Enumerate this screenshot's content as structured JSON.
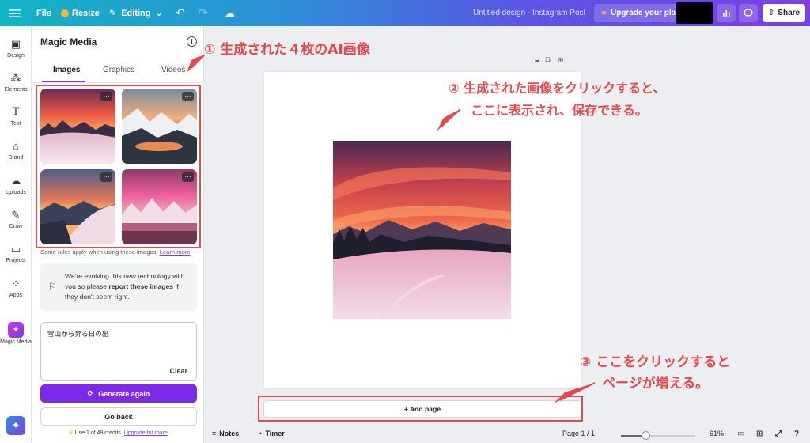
{
  "topbar": {
    "file_label": "File",
    "resize_label": "Resize",
    "editing_label": "Editing",
    "doc_title": "Untitled design - Instagram Post",
    "upgrade_label": "Upgrade your plan",
    "share_label": "Share"
  },
  "rail": {
    "items": [
      {
        "label": "Design",
        "icon": "design-icon"
      },
      {
        "label": "Elements",
        "icon": "elements-icon"
      },
      {
        "label": "Text",
        "icon": "text-icon"
      },
      {
        "label": "Brand",
        "icon": "brand-icon"
      },
      {
        "label": "Uploads",
        "icon": "uploads-icon"
      },
      {
        "label": "Draw",
        "icon": "draw-icon"
      },
      {
        "label": "Projects",
        "icon": "projects-icon"
      },
      {
        "label": "Apps",
        "icon": "apps-icon"
      },
      {
        "label": "Magic Media",
        "icon": "magic-media-icon"
      }
    ]
  },
  "panel": {
    "title": "Magic Media",
    "tabs": [
      {
        "label": "Images",
        "active": true
      },
      {
        "label": "Graphics",
        "active": false
      },
      {
        "label": "Videos",
        "active": false
      }
    ],
    "rules_text": "Some rules apply when using these images.",
    "rules_link": "Learn more",
    "notice_pre": "We're evolving this new technology with you so please ",
    "notice_link": "report these images",
    "notice_post": " if they don't seem right.",
    "prompt_text": "雪山から昇る日の出",
    "clear_label": "Clear",
    "generate_label": "Generate again",
    "back_label": "Go back",
    "credits_text": "Use 1 of 49 credits.",
    "credits_link": "Upgrade for more"
  },
  "canvas": {
    "add_page_label": "+ Add page"
  },
  "bottombar": {
    "notes_label": "Notes",
    "timer_label": "Timer",
    "page_indicator": "Page 1 / 1",
    "zoom_value": 61,
    "zoom_label": "61%"
  },
  "annotations": {
    "a1": "① 生成された４枚のAI画像",
    "a2_line1": "② 生成された画像をクリックすると、",
    "a2_line2": "ここに表示され、保存できる。",
    "a3_line1": "③ ここをクリックすると",
    "a3_line2": "ページが増える。"
  },
  "colors": {
    "accent": "#7d2ae8",
    "annotation": "#e5484d"
  }
}
